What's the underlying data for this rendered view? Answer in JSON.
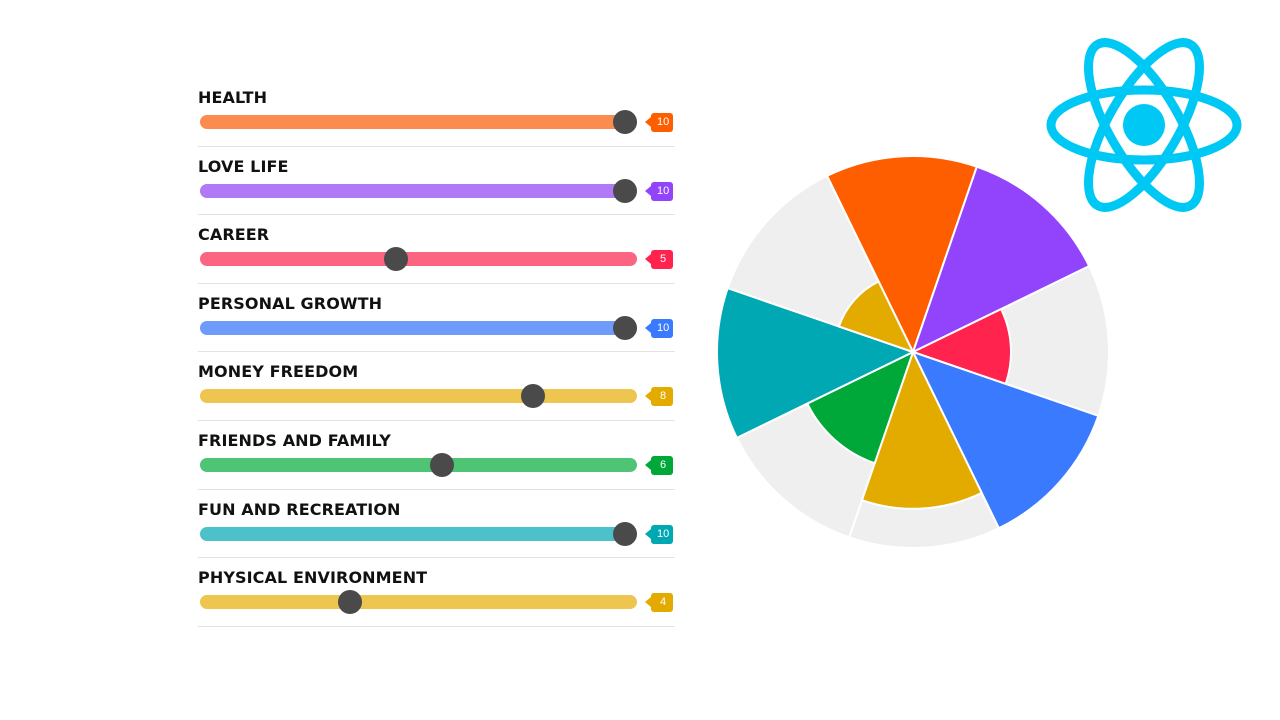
{
  "slider_range": {
    "min": 1,
    "max": 10
  },
  "categories": [
    {
      "label": "HEALTH",
      "value": 10,
      "display": "10",
      "track_color": "#fb8c4f",
      "accent": "#ff5e00"
    },
    {
      "label": "LOVE LIFE",
      "value": 10,
      "display": "10",
      "track_color": "#b07af7",
      "accent": "#9244fd"
    },
    {
      "label": "CAREER",
      "value": 5,
      "display": "5",
      "track_color": "#fb6581",
      "accent": "#ff234e"
    },
    {
      "label": "PERSONAL GROWTH",
      "value": 10,
      "display": "10",
      "track_color": "#6f9bfa",
      "accent": "#3a7afe"
    },
    {
      "label": "MONEY FREEDOM",
      "value": 8,
      "display": "8",
      "track_color": "#eec54e",
      "accent": "#e3ab00"
    },
    {
      "label": "FRIENDS AND FAMILY",
      "value": 6,
      "display": "6",
      "track_color": "#4ec474",
      "accent": "#00a83a"
    },
    {
      "label": "FUN AND RECREATION",
      "value": 10,
      "display": "10",
      "track_color": "#4dc1c9",
      "accent": "#00a8b4"
    },
    {
      "label": "PHYSICAL ENVIRONMENT",
      "value": 4,
      "display": "4",
      "track_color": "#eec54e",
      "accent": "#e3ab00"
    }
  ],
  "chart_data": {
    "type": "polar-area",
    "title": "",
    "categories": [
      "HEALTH",
      "LOVE LIFE",
      "CAREER",
      "PERSONAL GROWTH",
      "MONEY FREEDOM",
      "FRIENDS AND FAMILY",
      "FUN AND RECREATION",
      "PHYSICAL ENVIRONMENT"
    ],
    "values": [
      10,
      10,
      5,
      10,
      8,
      6,
      10,
      4
    ],
    "max": 10,
    "colors": [
      "#ff5e00",
      "#9244fd",
      "#ff234e",
      "#3a7afe",
      "#e3ab00",
      "#00a83a",
      "#00a8b4",
      "#e3ab00"
    ],
    "background_color": "#efefef",
    "direction": "clockwise",
    "start": "top"
  },
  "logo": {
    "name": "react-logo",
    "color": "#00c8f5"
  }
}
